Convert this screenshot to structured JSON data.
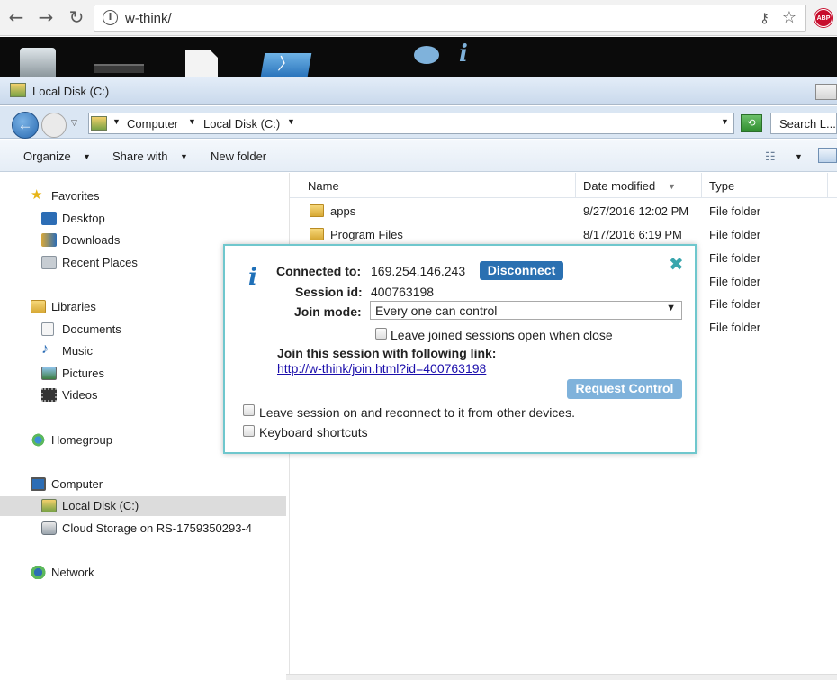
{
  "browser": {
    "url": "w-think/"
  },
  "explorer": {
    "window_title": "Local Disk (C:)",
    "breadcrumb": [
      "Computer",
      "Local Disk (C:)"
    ],
    "search_placeholder": "Search L...",
    "toolbar": {
      "organize": "Organize",
      "share_with": "Share with",
      "new_folder": "New folder"
    },
    "nav": {
      "favorites": "Favorites",
      "desktop": "Desktop",
      "downloads": "Downloads",
      "recent_places": "Recent Places",
      "libraries": "Libraries",
      "documents": "Documents",
      "music": "Music",
      "pictures": "Pictures",
      "videos": "Videos",
      "homegroup": "Homegroup",
      "computer": "Computer",
      "local_disk": "Local Disk (C:)",
      "cloud_storage": "Cloud Storage on RS-1759350293-4",
      "network": "Network"
    },
    "columns": {
      "name": "Name",
      "date_modified": "Date modified",
      "type": "Type"
    },
    "files": [
      {
        "name": "apps",
        "date": "9/27/2016 12:02 PM",
        "type": "File folder"
      },
      {
        "name": "Program Files",
        "date": "8/17/2016 6:19 PM",
        "type": "File folder"
      },
      {
        "name": "",
        "date": "",
        "type": "File folder"
      },
      {
        "name": "",
        "date": "",
        "type": "File folder"
      },
      {
        "name": "",
        "date": "",
        "type": "File folder"
      },
      {
        "name": "",
        "date": "",
        "type": "File folder"
      }
    ]
  },
  "dialog": {
    "connected_label": "Connected to:",
    "connected_ip": "169.254.146.243",
    "disconnect_label": "Disconnect",
    "session_label": "Session id:",
    "session_id": "400763198",
    "join_mode_label": "Join mode:",
    "join_mode_value": "Every one can control",
    "leave_joined_label": "Leave joined sessions open when close",
    "join_link_label": "Join this session with following link:",
    "join_link": "http://w-think/join.html?id=400763198",
    "request_control_label": "Request Control",
    "leave_session_label": "Leave session on and reconnect to it from other devices.",
    "keyboard_shortcuts_label": "Keyboard shortcuts",
    "close_glyph": "✖",
    "info_glyph": "i"
  },
  "colors": {
    "dialog_border": "#6fc7cd",
    "disconnect_bg": "#2a70b1",
    "request_control_bg": "#7fb2db",
    "link": "#1a0dab"
  }
}
